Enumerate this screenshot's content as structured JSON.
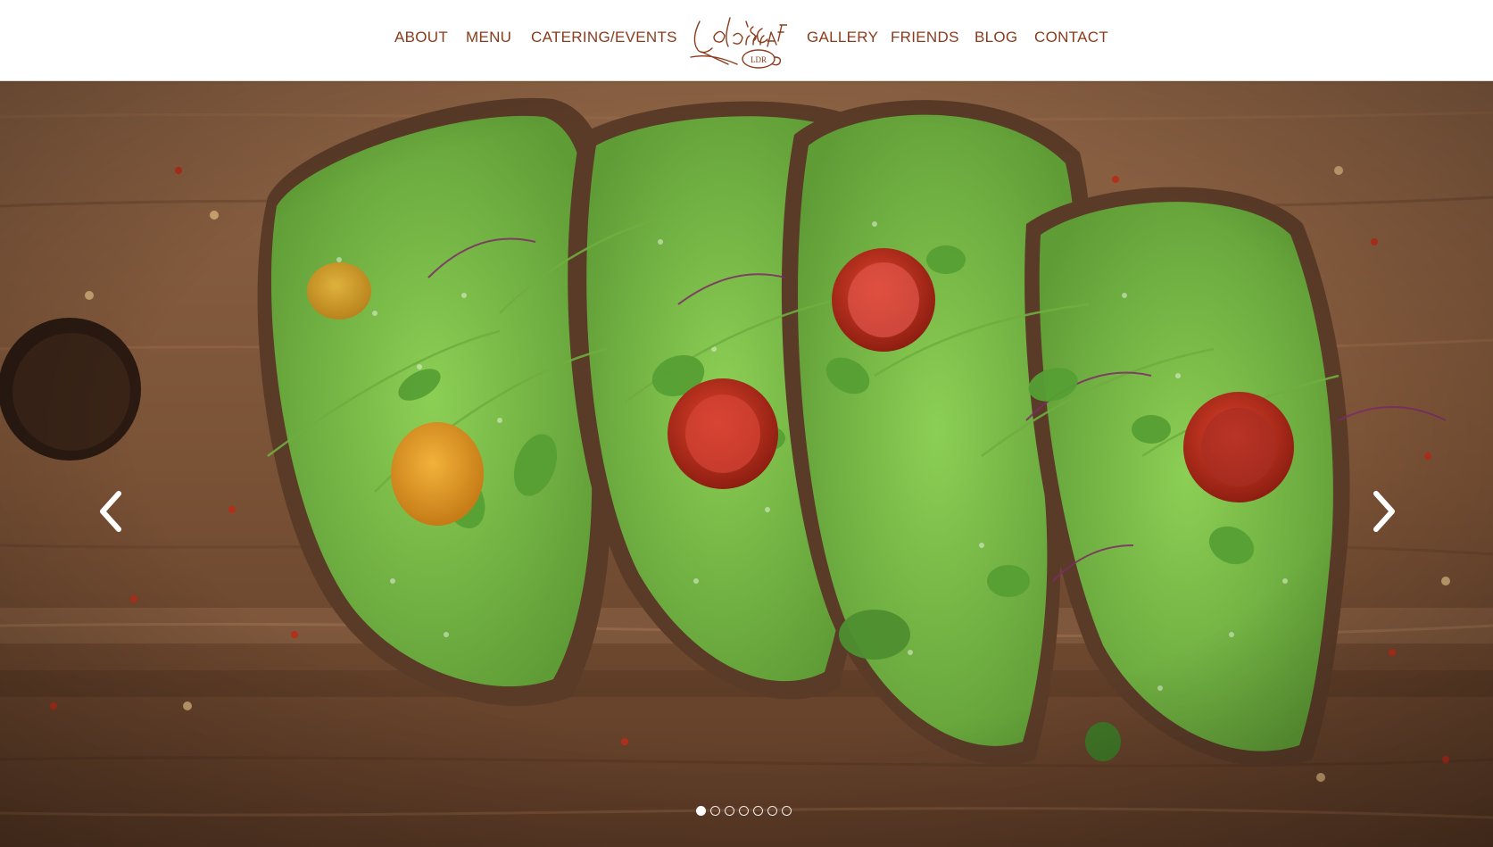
{
  "nav": {
    "left": [
      "ABOUT",
      "MENU",
      "CATERING/EVENTS"
    ],
    "right": [
      "GALLERY",
      "FRIENDS",
      "BLOG",
      "CONTACT"
    ]
  },
  "logo": {
    "text": "LOLA'S CAFE",
    "subtext": "LDR"
  },
  "slider": {
    "prev_icon": "chevron-left-icon",
    "next_icon": "chevron-right-icon",
    "slide_count": 7,
    "active_slide": 1,
    "image_subject": "avocado-toast-photo"
  },
  "colors": {
    "nav_text": "#8a3b1c",
    "header_bg": "#ffffff"
  }
}
